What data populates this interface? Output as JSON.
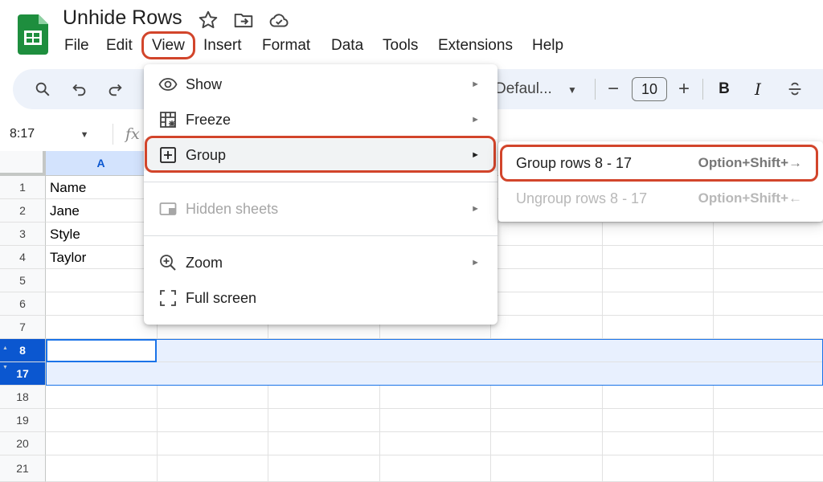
{
  "document": {
    "title": "Unhide Rows"
  },
  "menubar": [
    "File",
    "Edit",
    "View",
    "Insert",
    "Format",
    "Data",
    "Tools",
    "Extensions",
    "Help"
  ],
  "toolbar": {
    "font": "Defaul...",
    "font_size": "10",
    "bold": "B",
    "italic": "I"
  },
  "formula_bar": {
    "name_box": "8:17",
    "fx": "fx"
  },
  "grid": {
    "column_a": "A",
    "row_numbers": [
      "1",
      "2",
      "3",
      "4",
      "5",
      "6",
      "7",
      "8",
      "17",
      "18",
      "19",
      "20",
      "21"
    ],
    "cells_a": [
      "Name",
      "Jane",
      "Style",
      "Taylor"
    ]
  },
  "view_menu": {
    "show": "Show",
    "freeze": "Freeze",
    "group": "Group",
    "hidden_sheets": "Hidden sheets",
    "zoom": "Zoom",
    "full_screen": "Full screen",
    "arrow": "►"
  },
  "group_submenu": {
    "group_rows": "Group rows 8 - 17",
    "group_shortcut": "Option+Shift+→",
    "ungroup_rows": "Ungroup rows 8 - 17",
    "ungroup_shortcut": "Option+Shift+←"
  },
  "colors": {
    "accent": "#0b57d0",
    "callout": "#d2452b",
    "toolbar_bg": "#edf2fa",
    "sheets_green": "#1e8e3e"
  },
  "icons": [
    "sheets-logo-icon",
    "star-icon",
    "move-folder-icon",
    "cloud-saved-icon",
    "search-icon",
    "undo-icon",
    "redo-icon",
    "eye-icon",
    "freeze-grid-icon",
    "plus-box-icon",
    "hidden-sheet-icon",
    "zoom-in-icon",
    "fullscreen-icon"
  ]
}
